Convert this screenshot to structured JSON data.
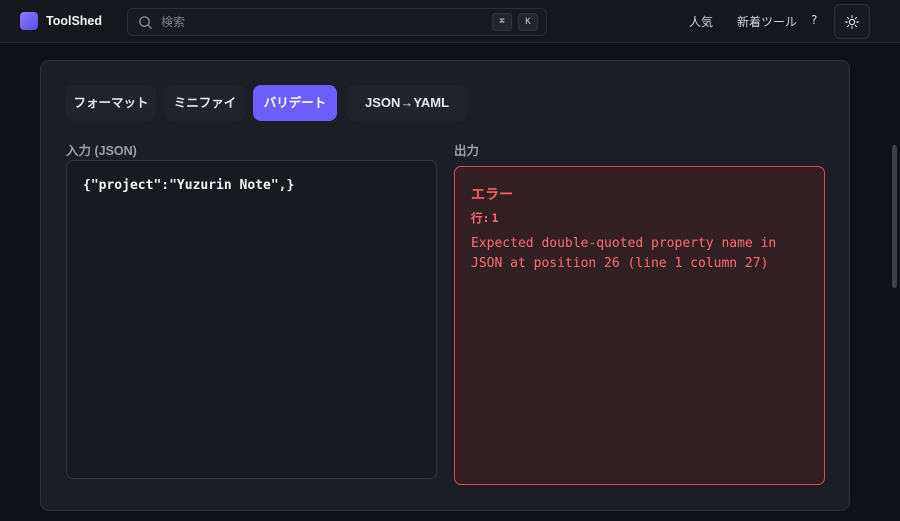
{
  "header": {
    "app_name": "ToolShed",
    "search": {
      "placeholder": "検索",
      "value": "",
      "shortcut_keys": [
        "⌘",
        "K"
      ]
    },
    "nav": {
      "popular": "人気",
      "new_tools": "新着ツール",
      "help": "?"
    },
    "theme_toggle_icon": "sun-icon"
  },
  "tabs": [
    {
      "label": "フォーマット",
      "active": false
    },
    {
      "label": "ミニファイ",
      "active": false
    },
    {
      "label": "バリデート",
      "active": true
    },
    {
      "label": "JSON→YAML",
      "active": false
    }
  ],
  "input": {
    "label": "入力 (JSON)",
    "value": "{\"project\":\"Yuzurin Note\",}"
  },
  "output": {
    "label": "出力",
    "error_title": "エラー",
    "line_label": "行:",
    "line_number": "1",
    "message": "Expected double-quoted property name in JSON at position 26 (line 1 column 27)"
  },
  "colors": {
    "accent": "#6d5efc",
    "error": "#ff5b63",
    "error_bg": "#321f24"
  }
}
